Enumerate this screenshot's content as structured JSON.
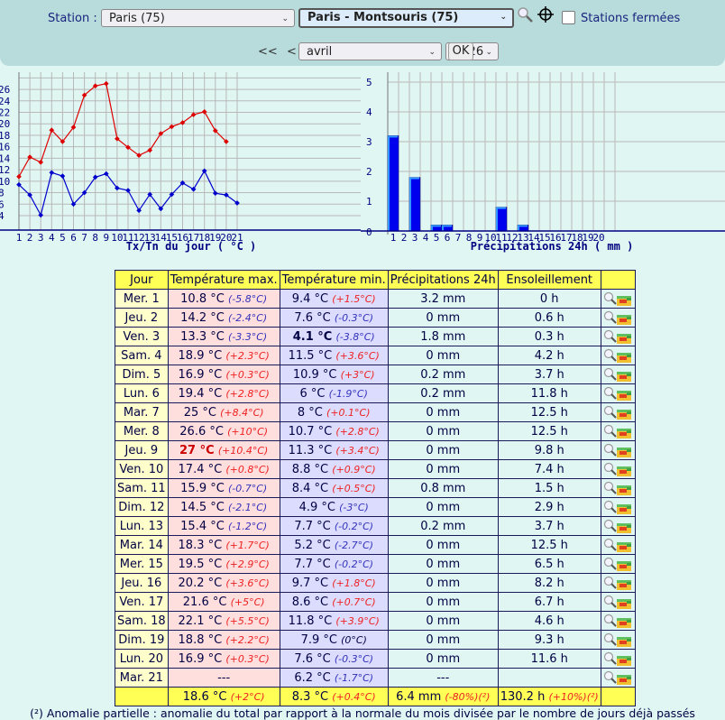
{
  "header": {
    "station_label": "Station :",
    "department_select": "Paris (75)",
    "station_select": "Paris - Montsouris (75)",
    "closed_stations_label": "Stations fermées",
    "prev_prev": "<<",
    "prev": "<",
    "month_select": "avril",
    "year_select": "2026",
    "ok_label": "OK"
  },
  "chart_data": [
    {
      "type": "line",
      "title": "Tx/Tn du jour ( °C )",
      "x": [
        1,
        2,
        3,
        4,
        5,
        6,
        7,
        8,
        9,
        10,
        11,
        12,
        13,
        14,
        15,
        16,
        17,
        18,
        19,
        20,
        21
      ],
      "x_tick_labels": [
        "1",
        "2",
        "3",
        "4",
        "5",
        "6",
        "7",
        "8",
        "9",
        "10",
        "11",
        "12",
        "13",
        "14",
        "15",
        "16",
        "17",
        "18",
        "19",
        "20",
        "21"
      ],
      "y_tick_labels": [
        "4",
        "6",
        "8",
        "10",
        "12",
        "14",
        "16",
        "18",
        "20",
        "22",
        "24",
        "26"
      ],
      "ylim": [
        1.5,
        29
      ],
      "series": [
        {
          "name": "Tx",
          "color": "#dd0000",
          "values": [
            10.8,
            14.2,
            13.3,
            18.9,
            16.9,
            19.4,
            25,
            26.6,
            27,
            17.4,
            15.9,
            14.5,
            15.4,
            18.3,
            19.5,
            20.2,
            21.6,
            22.1,
            18.8,
            16.9,
            null
          ]
        },
        {
          "name": "Tn",
          "color": "#0000cc",
          "values": [
            9.4,
            7.6,
            4.1,
            11.5,
            10.9,
            6,
            8,
            10.7,
            11.3,
            8.8,
            8.4,
            4.9,
            7.7,
            5.2,
            7.7,
            9.7,
            8.6,
            11.8,
            7.9,
            7.6,
            6.2
          ]
        }
      ]
    },
    {
      "type": "bar",
      "title": "Précipitations 24h ( mm )",
      "x_tick_labels": [
        "1",
        "2",
        "3",
        "4",
        "5",
        "6",
        "7",
        "8",
        "9",
        "10",
        "11",
        "12",
        "13",
        "14",
        "15",
        "16",
        "17",
        "18",
        "19",
        "20"
      ],
      "y_tick_labels": [
        "0",
        "1",
        "2",
        "3",
        "4",
        "5"
      ],
      "ylim": [
        0,
        5.3
      ],
      "values": [
        3.2,
        0,
        1.8,
        0,
        0.2,
        0.2,
        0,
        0,
        0,
        0,
        0.8,
        0,
        0.2,
        0,
        0,
        0,
        0,
        0,
        0,
        0
      ]
    }
  ],
  "table": {
    "headers": [
      "Jour",
      "Température max.",
      "Température min.",
      "Précipitations 24h",
      "Ensoleillement",
      ""
    ],
    "rows": [
      {
        "day": "Mer. 1",
        "tx": "10.8 °C",
        "txa": "(-5.8°C)",
        "tn": "9.4 °C",
        "tna": "(+1.5°C)",
        "pr": "3.2 mm",
        "su": "0 h"
      },
      {
        "day": "Jeu. 2",
        "tx": "14.2 °C",
        "txa": "(-2.4°C)",
        "tn": "7.6 °C",
        "tna": "(-0.3°C)",
        "pr": "0 mm",
        "su": "0.6 h"
      },
      {
        "day": "Ven. 3",
        "tx": "13.3 °C",
        "txa": "(-3.3°C)",
        "tn": "4.1 °C",
        "tna": "(-3.8°C)",
        "pr": "1.8 mm",
        "su": "0.3 h",
        "tn_bold": true
      },
      {
        "day": "Sam. 4",
        "tx": "18.9 °C",
        "txa": "(+2.3°C)",
        "tn": "11.5 °C",
        "tna": "(+3.6°C)",
        "pr": "0 mm",
        "su": "4.2 h"
      },
      {
        "day": "Dim. 5",
        "tx": "16.9 °C",
        "txa": "(+0.3°C)",
        "tn": "10.9 °C",
        "tna": "(+3°C)",
        "pr": "0.2 mm",
        "su": "3.7 h"
      },
      {
        "day": "Lun. 6",
        "tx": "19.4 °C",
        "txa": "(+2.8°C)",
        "tn": "6 °C",
        "tna": "(-1.9°C)",
        "pr": "0.2 mm",
        "su": "11.8 h"
      },
      {
        "day": "Mar. 7",
        "tx": "25 °C",
        "txa": "(+8.4°C)",
        "tn": "8 °C",
        "tna": "(+0.1°C)",
        "pr": "0 mm",
        "su": "12.5 h"
      },
      {
        "day": "Mer. 8",
        "tx": "26.6 °C",
        "txa": "(+10°C)",
        "tn": "10.7 °C",
        "tna": "(+2.8°C)",
        "pr": "0 mm",
        "su": "12.5 h"
      },
      {
        "day": "Jeu. 9",
        "tx": "27 °C",
        "txa": "(+10.4°C)",
        "tn": "11.3 °C",
        "tna": "(+3.4°C)",
        "pr": "0 mm",
        "su": "9.8 h",
        "tx_record": true
      },
      {
        "day": "Ven. 10",
        "tx": "17.4 °C",
        "txa": "(+0.8°C)",
        "tn": "8.8 °C",
        "tna": "(+0.9°C)",
        "pr": "0 mm",
        "su": "7.4 h"
      },
      {
        "day": "Sam. 11",
        "tx": "15.9 °C",
        "txa": "(-0.7°C)",
        "tn": "8.4 °C",
        "tna": "(+0.5°C)",
        "pr": "0.8 mm",
        "su": "1.5 h"
      },
      {
        "day": "Dim. 12",
        "tx": "14.5 °C",
        "txa": "(-2.1°C)",
        "tn": "4.9 °C",
        "tna": "(-3°C)",
        "pr": "0 mm",
        "su": "2.9 h"
      },
      {
        "day": "Lun. 13",
        "tx": "15.4 °C",
        "txa": "(-1.2°C)",
        "tn": "7.7 °C",
        "tna": "(-0.2°C)",
        "pr": "0.2 mm",
        "su": "3.7 h"
      },
      {
        "day": "Mar. 14",
        "tx": "18.3 °C",
        "txa": "(+1.7°C)",
        "tn": "5.2 °C",
        "tna": "(-2.7°C)",
        "pr": "0 mm",
        "su": "12.5 h"
      },
      {
        "day": "Mer. 15",
        "tx": "19.5 °C",
        "txa": "(+2.9°C)",
        "tn": "7.7 °C",
        "tna": "(-0.2°C)",
        "pr": "0 mm",
        "su": "6.5 h"
      },
      {
        "day": "Jeu. 16",
        "tx": "20.2 °C",
        "txa": "(+3.6°C)",
        "tn": "9.7 °C",
        "tna": "(+1.8°C)",
        "pr": "0 mm",
        "su": "8.2 h"
      },
      {
        "day": "Ven. 17",
        "tx": "21.6 °C",
        "txa": "(+5°C)",
        "tn": "8.6 °C",
        "tna": "(+0.7°C)",
        "pr": "0 mm",
        "su": "6.7 h"
      },
      {
        "day": "Sam. 18",
        "tx": "22.1 °C",
        "txa": "(+5.5°C)",
        "tn": "11.8 °C",
        "tna": "(+3.9°C)",
        "pr": "0 mm",
        "su": "4.6 h"
      },
      {
        "day": "Dim. 19",
        "tx": "18.8 °C",
        "txa": "(+2.2°C)",
        "tn": "7.9 °C",
        "tna": "(0°C)",
        "pr": "0 mm",
        "su": "9.3 h"
      },
      {
        "day": "Lun. 20",
        "tx": "16.9 °C",
        "txa": "(+0.3°C)",
        "tn": "7.6 °C",
        "tna": "(-0.3°C)",
        "pr": "0 mm",
        "su": "11.6 h"
      },
      {
        "day": "Mar. 21",
        "tx": "---",
        "txa": "",
        "tn": "6.2 °C",
        "tna": "(-1.7°C)",
        "pr": "---",
        "su": ""
      }
    ],
    "totals": {
      "tx": "18.6 °C",
      "txa": "(+2°C)",
      "tn": "8.3 °C",
      "tna": "(+0.4°C)",
      "pr": "6.4 mm",
      "pra": "(-80%)(²)",
      "su": "130.2 h",
      "sua": "(+10%)(²)"
    }
  },
  "footnote": "(²) Anomalie partielle : anomalie du total par rapport à la normale du mois divisée par le nombre de jours déjà passés"
}
